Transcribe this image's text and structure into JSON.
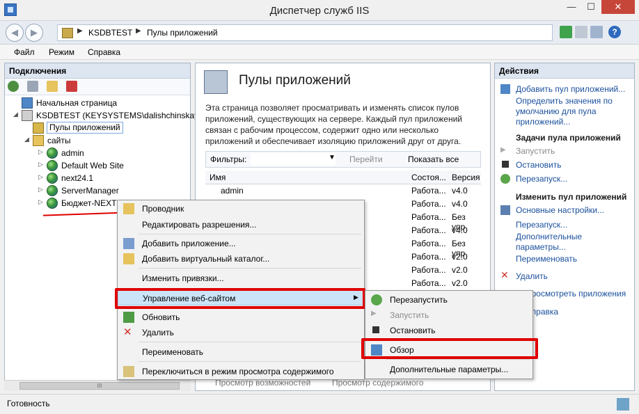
{
  "window": {
    "title": "Диспетчер служб IIS",
    "min": "—",
    "max": "☐",
    "close": "✕"
  },
  "address": {
    "crumbs": [
      "KSDBTEST",
      "Пулы приложений"
    ],
    "sep": "▶"
  },
  "menu": [
    "Файл",
    "Режим",
    "Справка"
  ],
  "connections": {
    "header": "Подключения",
    "tree": [
      {
        "label": "Начальная страница"
      },
      {
        "label": "KSDBTEST (KEYSYSTEMS\\dalishchinskaya)"
      },
      {
        "label": "Пулы приложений"
      },
      {
        "label": "сайты"
      },
      {
        "label": "admin"
      },
      {
        "label": "Default Web Site"
      },
      {
        "label": "next24.1"
      },
      {
        "label": "ServerManager"
      },
      {
        "label": "Бюджет-NEXT"
      }
    ],
    "scroll_thumb": "III"
  },
  "center": {
    "title": "Пулы приложений",
    "description": "Эта страница позволяет просматривать и изменять список пулов приложений, существующих на сервере. Каждый пул приложений связан с рабочим процессом, содержит одно или несколько приложений и обеспечивает изоляцию приложений друг от друга.",
    "filter_label": "Фильтры:",
    "go_label": "Перейти",
    "show_all_label": "Показать все",
    "columns": [
      "Имя",
      "Состоя...",
      "Версия"
    ],
    "rows": [
      {
        "name": "admin",
        "state": "Работа...",
        "version": "v4.0"
      },
      {
        "name": "",
        "state": "Работа...",
        "version": "v4.0"
      },
      {
        "name": "",
        "state": "Работа...",
        "version": "Без упр"
      },
      {
        "name": "",
        "state": "Работа...",
        "version": "v4.0"
      },
      {
        "name": "",
        "state": "Работа...",
        "version": "Без упр"
      },
      {
        "name": "",
        "state": "Работа...",
        "version": "v2.0"
      },
      {
        "name": "",
        "state": "Работа...",
        "version": "v2.0"
      },
      {
        "name": "",
        "state": "Работа...",
        "version": "v2.0"
      }
    ],
    "footer_features": "Просмотр возможностей",
    "footer_content": "Просмотр содержимого"
  },
  "actions": {
    "header": "Действия",
    "add_pool": "Добавить пул приложений...",
    "set_defaults": "Определить значения по умолчанию для пула приложений...",
    "tasks_head": "Задачи пула приложений",
    "start": "Запустить",
    "stop": "Остановить",
    "restart": "Перезапуск...",
    "edit_head": "Изменить пул приложений",
    "basic": "Основные настройки...",
    "recycle": "Перезапуск...",
    "advanced": "Дополнительные параметры...",
    "rename": "Переименовать",
    "delete": "Удалить",
    "view_apps": "Просмотреть приложения",
    "help": "Справка"
  },
  "context_menu": {
    "items": [
      "Проводник",
      "Редактировать разрешения...",
      "Добавить приложение...",
      "Добавить виртуальный каталог...",
      "Изменить привязки...",
      "Управление веб-сайтом",
      "Обновить",
      "Удалить",
      "Переименовать",
      "Переключиться в режим просмотра содержимого"
    ],
    "arrow": "▶"
  },
  "submenu": {
    "items": [
      "Перезапустить",
      "Запустить",
      "Остановить",
      "Обзор",
      "Дополнительные параметры..."
    ]
  },
  "status": {
    "text": "Готовность"
  }
}
